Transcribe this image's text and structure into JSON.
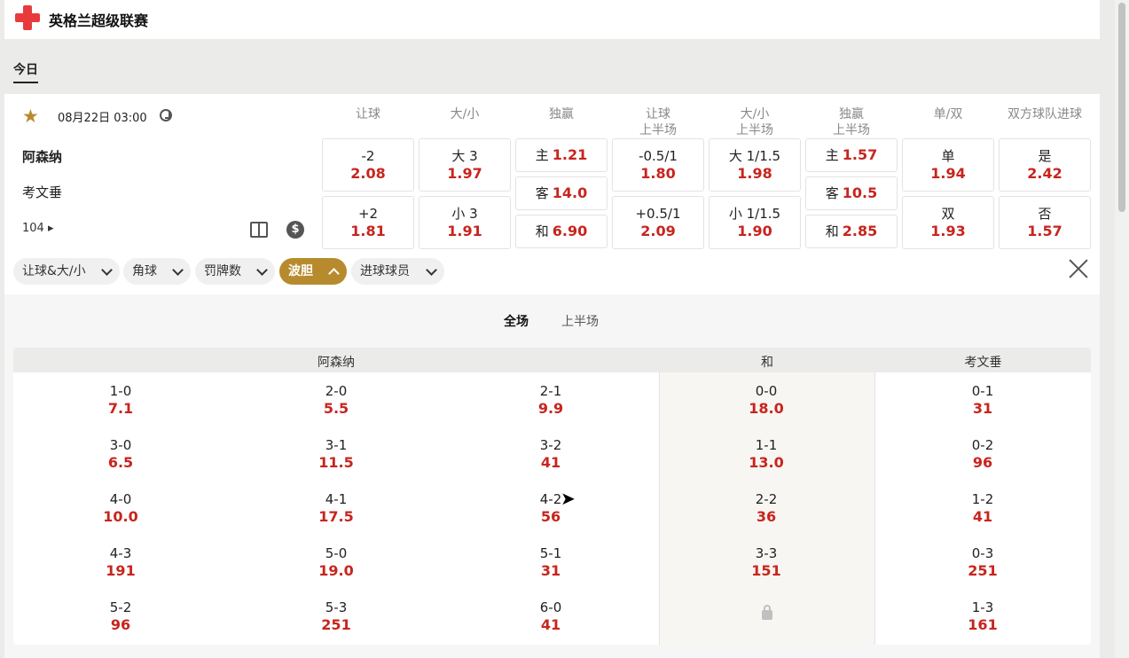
{
  "league": {
    "name": "英格兰超级联赛"
  },
  "tabs": {
    "today": "今日"
  },
  "match": {
    "datetime": "08月22日 03:00",
    "home": "阿森纳",
    "away": "考文垂",
    "more_count": "104",
    "icons": [
      "star-icon",
      "clock-icon",
      "chevron-right-icon",
      "pitch-icon",
      "dollar-icon"
    ]
  },
  "columns": [
    {
      "line1": "让球",
      "line2": ""
    },
    {
      "line1": "大/小",
      "line2": ""
    },
    {
      "line1": "独赢",
      "line2": ""
    },
    {
      "line1": "让球",
      "line2": "上半场"
    },
    {
      "line1": "大/小",
      "line2": "上半场"
    },
    {
      "line1": "独赢",
      "line2": "上半场"
    },
    {
      "line1": "单/双",
      "line2": ""
    },
    {
      "line1": "双方球队进球",
      "line2": ""
    }
  ],
  "odds": {
    "hdp": [
      {
        "label": "-2",
        "odds": "2.08"
      },
      {
        "label": "+2",
        "odds": "1.81"
      }
    ],
    "ou": [
      {
        "label": "大 3",
        "odds": "1.97"
      },
      {
        "label": "小 3",
        "odds": "1.91"
      }
    ],
    "x12": [
      {
        "label": "主",
        "odds": "1.21"
      },
      {
        "label": "客",
        "odds": "14.0"
      },
      {
        "label": "和",
        "odds": "6.90"
      }
    ],
    "hdp_ht": [
      {
        "label": "-0.5/1",
        "odds": "1.80"
      },
      {
        "label": "+0.5/1",
        "odds": "2.09"
      }
    ],
    "ou_ht": [
      {
        "label": "大 1/1.5",
        "odds": "1.98"
      },
      {
        "label": "小 1/1.5",
        "odds": "1.90"
      }
    ],
    "x12_ht": [
      {
        "label": "主",
        "odds": "1.57"
      },
      {
        "label": "客",
        "odds": "10.5"
      },
      {
        "label": "和",
        "odds": "2.85"
      }
    ],
    "oe": [
      {
        "label": "单",
        "odds": "1.94"
      },
      {
        "label": "双",
        "odds": "1.93"
      }
    ],
    "btts": [
      {
        "label": "是",
        "odds": "2.42"
      },
      {
        "label": "否",
        "odds": "1.57"
      }
    ]
  },
  "filters": [
    "让球&大/小",
    "角球",
    "罚牌数",
    "波胆",
    "进球球员"
  ],
  "active_filter": "波胆",
  "accent_color": "#b78b2d",
  "odds_color": "#c7251e",
  "periods": [
    "全场",
    "上半场"
  ],
  "correct_score": {
    "headers": {
      "home": "阿森纳",
      "draw": "和",
      "away": "考文垂"
    },
    "rows": [
      [
        {
          "s": "1-0",
          "o": "7.1"
        },
        {
          "s": "2-0",
          "o": "5.5"
        },
        {
          "s": "2-1",
          "o": "9.9"
        },
        {
          "s": "0-0",
          "o": "18.0"
        },
        {
          "s": "0-1",
          "o": "31"
        }
      ],
      [
        {
          "s": "3-0",
          "o": "6.5"
        },
        {
          "s": "3-1",
          "o": "11.5"
        },
        {
          "s": "3-2",
          "o": "41"
        },
        {
          "s": "1-1",
          "o": "13.0"
        },
        {
          "s": "0-2",
          "o": "96"
        }
      ],
      [
        {
          "s": "4-0",
          "o": "10.0"
        },
        {
          "s": "4-1",
          "o": "17.5"
        },
        {
          "s": "4-2",
          "o": "56"
        },
        {
          "s": "2-2",
          "o": "36"
        },
        {
          "s": "1-2",
          "o": "41"
        }
      ],
      [
        {
          "s": "4-3",
          "o": "191"
        },
        {
          "s": "5-0",
          "o": "19.0"
        },
        {
          "s": "5-1",
          "o": "31"
        },
        {
          "s": "3-3",
          "o": "151"
        },
        {
          "s": "0-3",
          "o": "251"
        }
      ],
      [
        {
          "s": "5-2",
          "o": "96"
        },
        {
          "s": "5-3",
          "o": "251"
        },
        {
          "s": "6-0",
          "o": "41"
        },
        {
          "s": "",
          "o": ""
        },
        {
          "s": "1-3",
          "o": "161"
        }
      ]
    ],
    "locked_icon": "lock-icon"
  }
}
